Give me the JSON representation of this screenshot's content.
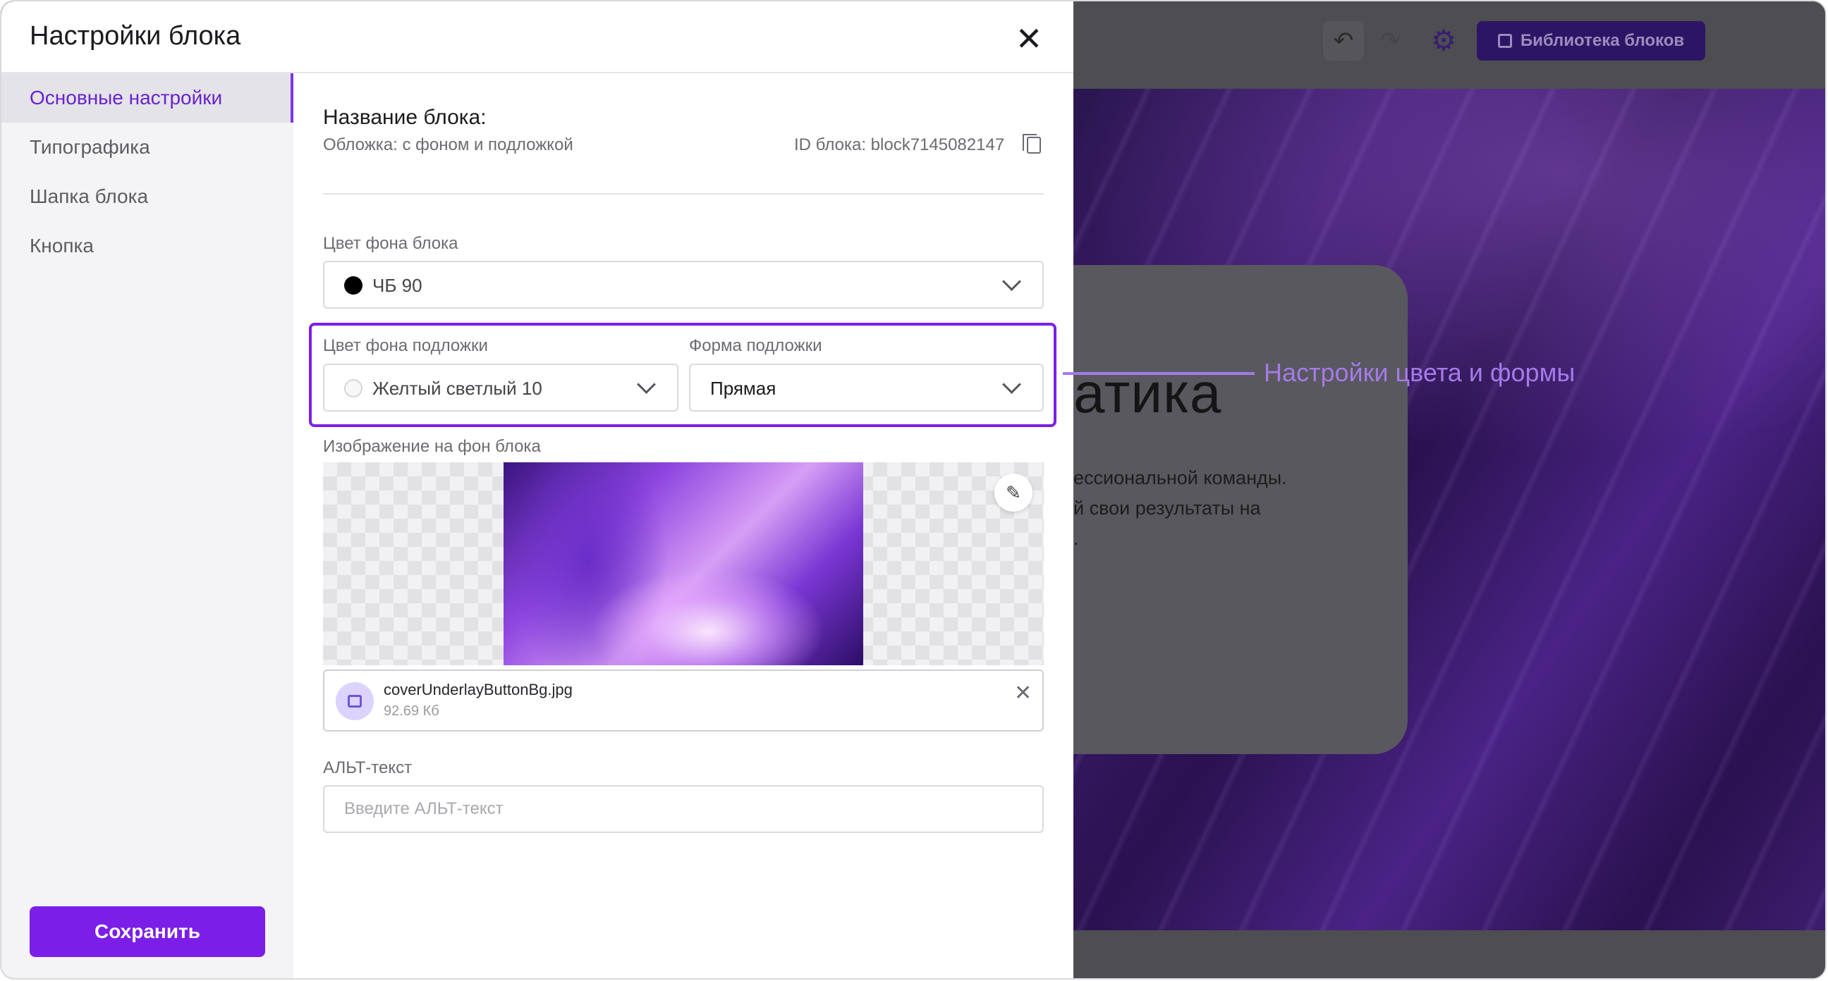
{
  "background": {
    "toolbar": {
      "undo_icon": "↶",
      "redo_icon": "↷",
      "settings_icon": "⚙",
      "library_label": "Библиотека блоков"
    },
    "hero": {
      "title_fragment": "атика",
      "text_lines": [
        "ессиональной команды.",
        "й свои результаты на",
        "."
      ]
    }
  },
  "annotation": {
    "label": "Настройки цвета и формы",
    "color": "#a57ae8"
  },
  "modal": {
    "title": "Настройки блока",
    "close_icon": "✕",
    "sidebar": {
      "items": [
        {
          "label": "Основные настройки",
          "active": true
        },
        {
          "label": "Типографика",
          "active": false
        },
        {
          "label": "Шапка блока",
          "active": false
        },
        {
          "label": "Кнопка",
          "active": false
        }
      ],
      "save_label": "Сохранить"
    },
    "main": {
      "name_heading": "Название блока:",
      "name_value": "Обложка: с фоном и подложкой",
      "block_id": "ID блока: block7145082147",
      "bg_color": {
        "label": "Цвет фона блока",
        "value": "ЧБ 90",
        "swatch": "#000000"
      },
      "underlay_color": {
        "label": "Цвет фона подложки",
        "value": "Желтый светлый 10",
        "swatch": "#f7f7f5"
      },
      "underlay_shape": {
        "label": "Форма подложки",
        "value": "Прямая"
      },
      "image": {
        "label": "Изображение на фон блока",
        "edit_icon": "✎",
        "file_name": "coverUnderlayButtonBg.jpg",
        "file_size": "92.69 Кб",
        "remove_icon": "✕"
      },
      "alt_text": {
        "label": "АЛЬТ-текст",
        "placeholder": "Введите АЛЬТ-текст",
        "value": ""
      }
    }
  },
  "colors": {
    "accent": "#7b1fe8",
    "active_text": "#6a23cc"
  }
}
